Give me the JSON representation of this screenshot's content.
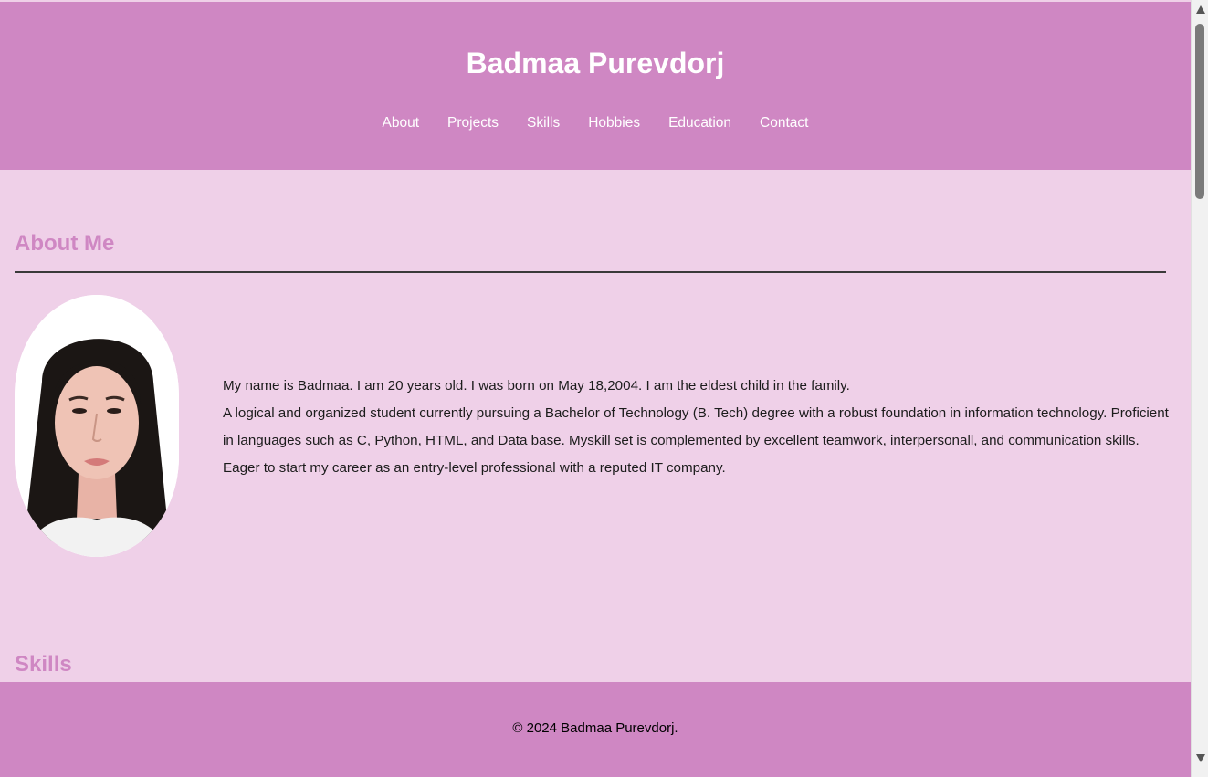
{
  "header": {
    "title": "Badmaa Purevdorj",
    "nav": [
      "About",
      "Projects",
      "Skills",
      "Hobbies",
      "Education",
      "Contact"
    ]
  },
  "about": {
    "title": "About Me",
    "paragraph1": "My name is Badmaa. I am 20 years old. I was born on May 18,2004. I am the eldest child in the family.",
    "paragraph2": "A logical and organized student currently pursuing a Bachelor of Technology (B. Tech) degree with a robust foundation in information technology. Proficient in languages such as C, Python, HTML, and Data base. Myskill set is complemented by excellent teamwork, interpersonall, and communication skills. Eager to start my career as an entry-level professional with a reputed IT company."
  },
  "skills": {
    "title": "Skills"
  },
  "footer": {
    "copyright": "© 2024 Badmaa Purevdorj."
  },
  "colors": {
    "header_bg": "#cf87c3",
    "page_bg": "#efd0e8",
    "heading_accent": "#cf87c3"
  }
}
